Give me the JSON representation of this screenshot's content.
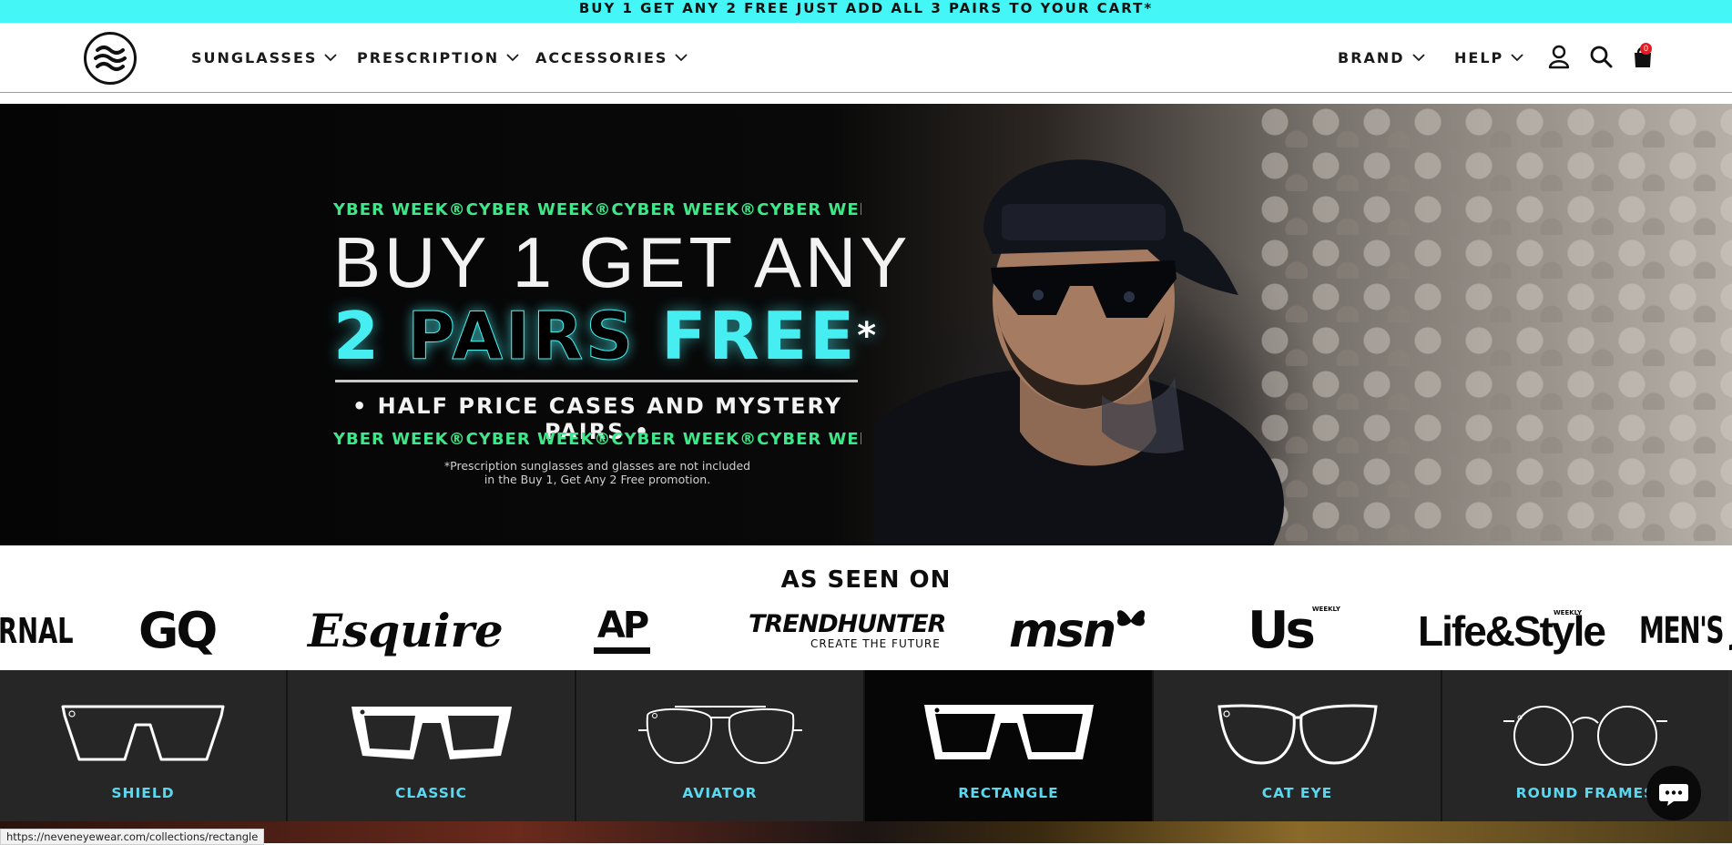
{
  "announcement": "BUY 1 GET ANY 2 FREE JUST ADD ALL 3 PAIRS TO YOUR CART*",
  "nav": {
    "left": [
      "SUNGLASSES",
      "PRESCRIPTION",
      "ACCESSORIES"
    ],
    "right": [
      "BRAND",
      "HELP"
    ],
    "icons": [
      "account-icon",
      "search-icon",
      "cart-icon"
    ],
    "cart_count": "0"
  },
  "hero": {
    "marquee_top": "YBER WEEK®CYBER WEEK®CYBER WEEK®CYBER WEEK®CYB",
    "line1": "BUY 1 GET ANY",
    "line2_number": "2",
    "line2_pairs": "PAIRS",
    "line2_free": "FREE",
    "line2_star": "*",
    "line3": "• HALF PRICE CASES AND MYSTERY PAIRS •",
    "marquee_bottom": "YBER WEEK®CYBER WEEK®CYBER WEEK®CYBER WEEK®CYB",
    "disclaimer_1": "*Prescription sunglasses and glasses are not included",
    "disclaimer_2": "in the Buy 1, Get Any 2 Free promotion."
  },
  "press": {
    "title": "AS SEEN ON",
    "logos": [
      "RNAL",
      "GQ",
      "Esquire",
      "AP",
      "TRENDHUNTER",
      "CREATE THE FUTURE",
      "msn",
      "Us",
      "WEEKLY",
      "Life&Style",
      "WEEKLY",
      "MEN'S JO"
    ]
  },
  "categories": [
    {
      "label": "SHIELD"
    },
    {
      "label": "CLASSIC"
    },
    {
      "label": "AVIATOR"
    },
    {
      "label": "RECTANGLE"
    },
    {
      "label": "CAT EYE"
    },
    {
      "label": "ROUND FRAMES"
    }
  ],
  "status_url": "https://neveneyewear.com/collections/rectangle",
  "colors": {
    "announcement_bg": "#44f6f6",
    "accent_cyan": "#47eef1",
    "marquee_green": "#3ee88a",
    "category_label": "#5ad8ef",
    "cart_badge": "#e51b23"
  }
}
